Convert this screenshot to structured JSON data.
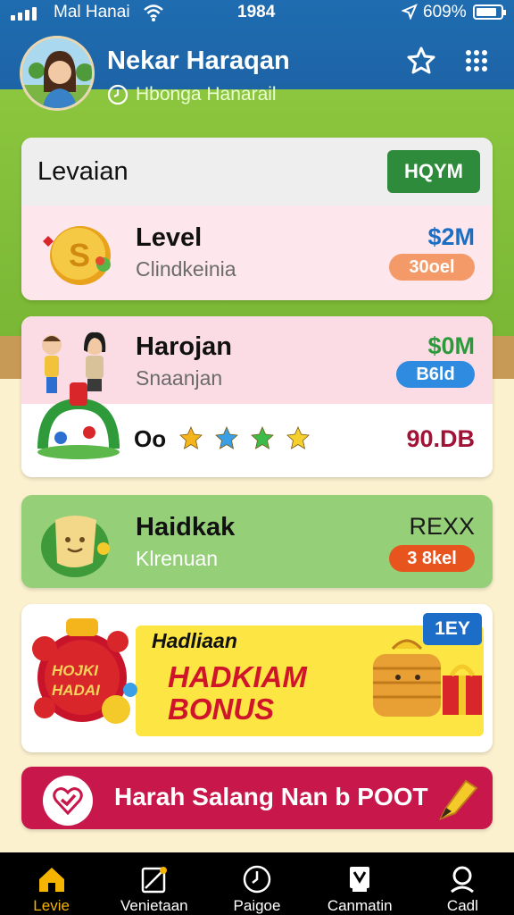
{
  "status_bar": {
    "carrier": "Mal Hanai",
    "time": "1984",
    "battery": "609%"
  },
  "header": {
    "user_name": "Nekar Haraqan",
    "user_subtitle": "Hbonga Hanarail",
    "icons": [
      "avatar",
      "star-icon",
      "grid-icon",
      "clock-icon"
    ]
  },
  "card1": {
    "header_title": "Levaian",
    "header_button": "HQYM",
    "item_title": "Level",
    "item_subtitle": "Clindkeinia",
    "price": "$2M",
    "pill": "30oel",
    "pill_color": "#f39a68"
  },
  "card2": {
    "title": "Harojan",
    "subtitle": "Snaanjan",
    "price": "$0M",
    "pill": "B6ld",
    "pill_color": "#2f8be0",
    "footer_prefix": "Oo",
    "footer_value": "90.DB",
    "star_colors": [
      "#f4b51c",
      "#3a9fe4",
      "#3dbb4a",
      "#f4cf2e"
    ]
  },
  "card3": {
    "title": "Haidkak",
    "subtitle": "Klrenuan",
    "price": "REXX",
    "pill": "3 8kel",
    "pill_color": "#e8541e"
  },
  "card4": {
    "tag": "1EY",
    "banner_small": "Hadliaan",
    "banner_big_line1": "HADKIAM",
    "banner_big_line2": "BONUS",
    "badge_text_line1": "HOJKI",
    "badge_text_line2": "HADAI"
  },
  "cta": {
    "label": "Harah Salang Nan b POOT"
  },
  "nav": {
    "items": [
      {
        "label": "Levie",
        "icon": "home-icon",
        "active": true
      },
      {
        "label": "Venietaan",
        "icon": "ticket-icon",
        "active": false
      },
      {
        "label": "Paigoe",
        "icon": "clock-icon",
        "active": false
      },
      {
        "label": "Canmatin",
        "icon": "badge-icon",
        "active": false
      },
      {
        "label": "Cadl",
        "icon": "search-icon",
        "active": false
      }
    ]
  }
}
